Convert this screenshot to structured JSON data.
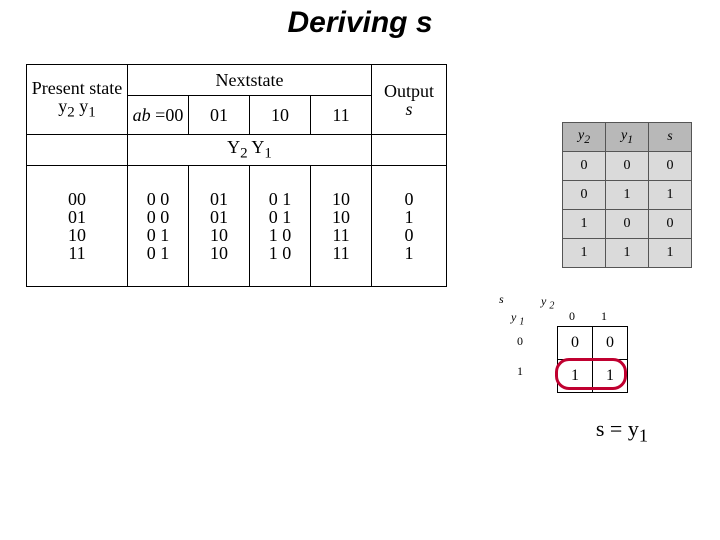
{
  "title": "Deriving  s",
  "state_table": {
    "present_label": "Present\nstate",
    "present_var_html": "y<sub>2</sub> y<sub>1</sub>",
    "next_label": "Nextstate",
    "ab_label_html": "<span class='it'>ab</span> =00",
    "ab_cols": [
      "01",
      "10",
      "11"
    ],
    "next_var_html": "Y<sub>2</sub> Y<sub>1</sub>",
    "output_label": "Output",
    "output_var_html": "<span class='it'>s</span>",
    "rows": [
      {
        "ps": "00",
        "ns": [
          "0 0",
          "01",
          "0 1",
          "10"
        ],
        "out": "0"
      },
      {
        "ps": "01",
        "ns": [
          "0 0",
          "01",
          "0 1",
          "10"
        ],
        "out": "1"
      },
      {
        "ps": "10",
        "ns": [
          "0 1",
          "10",
          "1 0",
          "11"
        ],
        "out": "0"
      },
      {
        "ps": "11",
        "ns": [
          "0 1",
          "10",
          "1 0",
          "11"
        ],
        "out": "1"
      }
    ]
  },
  "truth_table": {
    "headers_html": [
      "y<sub>2</sub>",
      "y<sub>1</sub>",
      "s"
    ],
    "rows": [
      [
        "0",
        "0",
        "0"
      ],
      [
        "0",
        "1",
        "1"
      ],
      [
        "1",
        "0",
        "0"
      ],
      [
        "1",
        "1",
        "1"
      ]
    ]
  },
  "kmap": {
    "corner_html": "s",
    "top_html": "y <sub>2</sub>",
    "side_html": "y <sub>1</sub>",
    "col_headers": [
      "0",
      "1"
    ],
    "row_headers": [
      "0",
      "1"
    ],
    "cells": [
      [
        "0",
        "0"
      ],
      [
        "1",
        "1"
      ]
    ]
  },
  "result_html": "s = y<sub>1</sub>",
  "chart_data": {
    "type": "table",
    "tables": [
      {
        "name": "state_table",
        "columns": [
          "present_state_y2y1",
          "Y2Y1_ab00",
          "Y2Y1_ab01",
          "Y2Y1_ab10",
          "Y2Y1_ab11",
          "output_s"
        ],
        "rows": [
          [
            "00",
            "00",
            "01",
            "01",
            "10",
            "0"
          ],
          [
            "01",
            "00",
            "01",
            "01",
            "10",
            "1"
          ],
          [
            "10",
            "01",
            "10",
            "10",
            "11",
            "0"
          ],
          [
            "11",
            "01",
            "10",
            "10",
            "11",
            "1"
          ]
        ]
      },
      {
        "name": "truth_table_s",
        "columns": [
          "y2",
          "y1",
          "s"
        ],
        "rows": [
          [
            "0",
            "0",
            "0"
          ],
          [
            "0",
            "1",
            "1"
          ],
          [
            "1",
            "0",
            "0"
          ],
          [
            "1",
            "1",
            "1"
          ]
        ]
      },
      {
        "name": "kmap_s",
        "row_var": "y1",
        "col_var": "y2",
        "grid": [
          [
            0,
            0
          ],
          [
            1,
            1
          ]
        ],
        "groups": [
          {
            "cells": [
              [
                1,
                0
              ],
              [
                1,
                1
              ]
            ],
            "term": "y1"
          }
        ],
        "result": "s = y1"
      }
    ]
  }
}
